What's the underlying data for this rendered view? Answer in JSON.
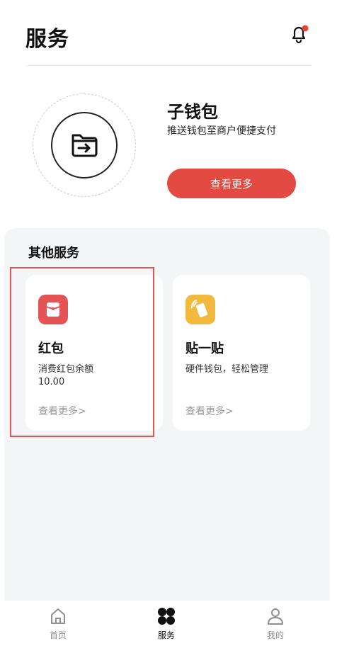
{
  "header": {
    "title": "服务"
  },
  "featured": {
    "title": "子钱包",
    "subtitle": "推送钱包至商户便捷支付",
    "button_label": "查看更多"
  },
  "other_services": {
    "title": "其他服务",
    "cards": [
      {
        "title": "红包",
        "description": "消费红包余额",
        "value": "10.00",
        "link": "查看更多>",
        "icon": "red-envelope-icon",
        "icon_color": "#e55454"
      },
      {
        "title": "贴一贴",
        "description": "硬件钱包，轻松管理",
        "link": "查看更多>",
        "icon": "tap-card-icon",
        "icon_color": "#f3b93c"
      }
    ]
  },
  "tabbar": {
    "items": [
      {
        "label": "首页",
        "icon": "home-icon",
        "active": false
      },
      {
        "label": "服务",
        "icon": "services-icon",
        "active": true
      },
      {
        "label": "我的",
        "icon": "profile-icon",
        "active": false
      }
    ]
  },
  "colors": {
    "accent": "#e24a42",
    "notification_dot": "#e5443b",
    "panel_bg": "#f4f5f7"
  }
}
